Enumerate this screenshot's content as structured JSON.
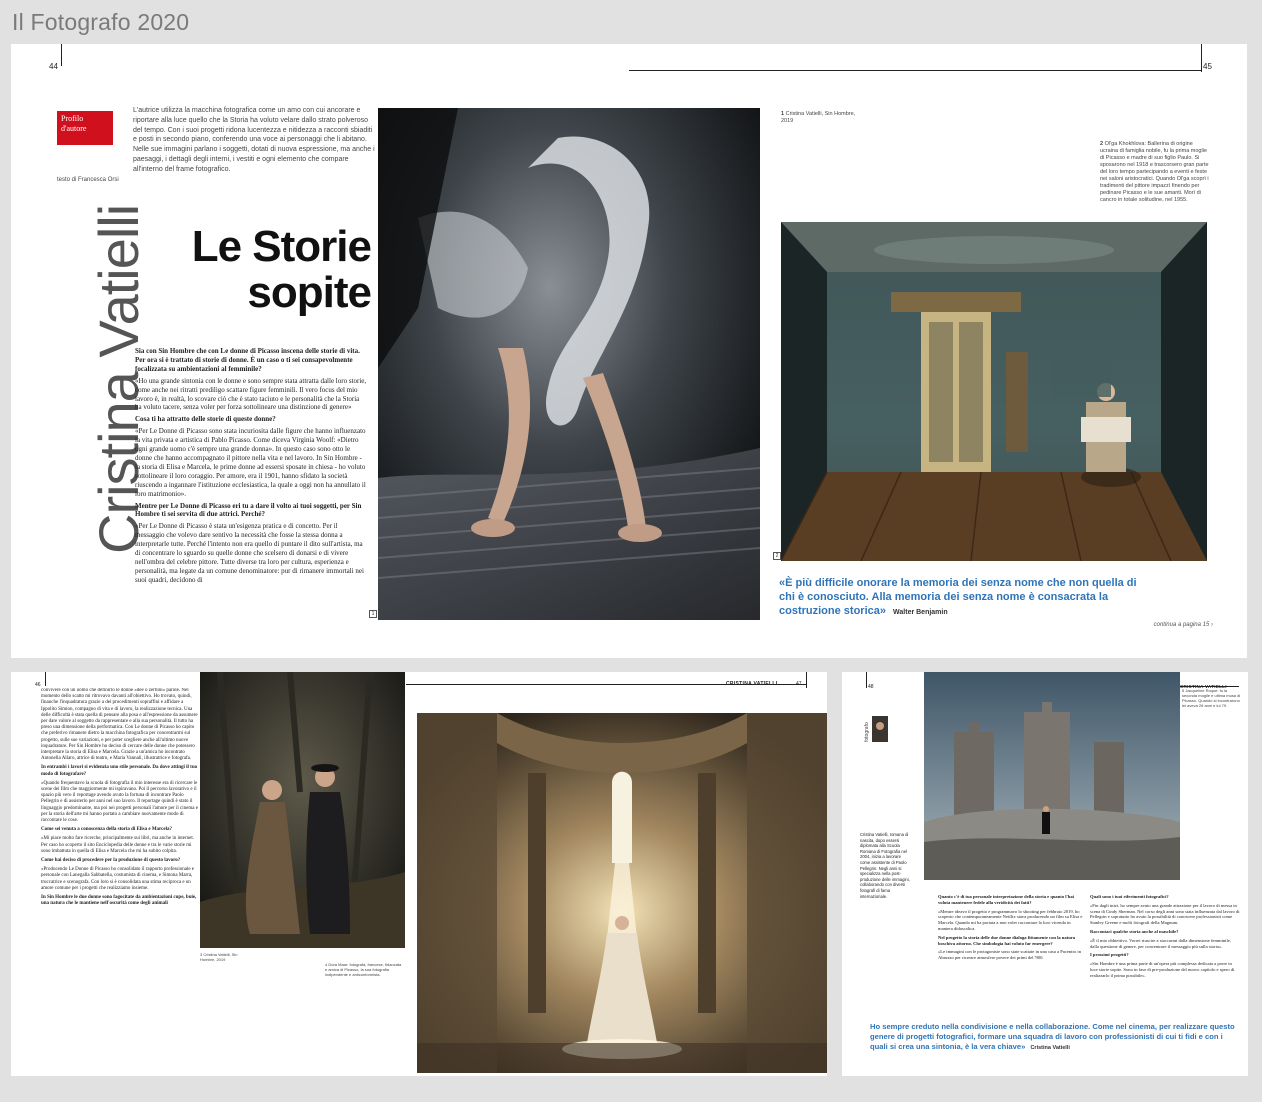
{
  "app": {
    "title": "Il Fotografo 2020"
  },
  "top_spread": {
    "page_left": "44",
    "page_right": "45",
    "section_label": "Profilo d'autore",
    "byline": "testo di Francesca Orsi",
    "author_name": "Cristina Vatielli",
    "headline_line1": "Le Storie",
    "headline_line2": "sopite",
    "intro_text": "L'autrice utilizza la macchina fotografica come un amo con cui ancorare e riportare alla luce quello che la Storia ha voluto velare dallo strato polveroso del tempo. Con i suoi progetti ridona lucentezza e nitidezza a racconti sbiaditi e posti in secondo piano, conferendo una voce ai personaggi che li abitano. Nelle sue immagini parlano i soggetti, dotati di nuova espressione, ma anche i paesaggi, i dettagli degli interni, i vestiti e ogni elemento che compare all'interno del frame fotografico.",
    "q1": "Sia con Sin Hombre che con Le donne di Picasso inscena delle storie di vita. Per ora si è trattato di storie di donne. È un caso o ti sei consapevolmente focalizzata su ambientazioni al femminile?",
    "a1": "«Ho una grande sintonia con le donne e sono sempre stata attratta dalle loro storie, come anche nei ritratti prediligo scattare figure femminili. Il vero focus del mio lavoro è, in realtà, lo scovare ciò che è stato taciuto e le personalità che la Storia ha voluto tacere, senza voler per forza sottolineare una distinzione di genere»",
    "q2": "Cosa ti ha attratto delle storie di queste donne?",
    "a2": "«Per Le Donne di Picasso sono stata incuriosita dalle figure che hanno influenzato la vita privata e artistica di Pablo Picasso. Come diceva Virginia Woolf: «Dietro ogni grande uomo c'è sempre una grande donna». In questo caso sono otto le donne che hanno accompagnato il pittore nella vita e nel lavoro. In Sin Hombre - la storia di Elisa e Marcela, le prime donne ad essersi sposate in chiesa - ho voluto sottolineare il loro coraggio. Per amore, era il 1901, hanno sfidato la società riuscendo a ingannare l'istituzione ecclesiastica, la quale a oggi non ha annullato il loro matrimonio».",
    "q3": "Mentre per Le Donne di Picasso eri tu a dare il volto ai tuoi soggetti, per Sin Hombre ti sei servita di due attrici. Perché?",
    "a3": "«Per Le Donne di Picasso è stata un'esigenza pratica e di concetto. Per il messaggio che volevo dare sentivo la necessità che fosse la stessa donna a interpretarle tutte. Perché l'intento non era quello di puntare il dito sull'artista, ma di concentrare lo sguardo su quelle donne che scelsero di donarsi e di vivere nell'ombra del celebre pittore. Tutte diverse tra loro per cultura, esperienza e personalità, ma legate da un comune denominatore: pur di rimanere immortali nei suoi quadri, decidono di",
    "photo1_num": "1",
    "caption1_num": "1",
    "caption1": "Cristina Vatielli, Sin Hombre, 2019",
    "caption2_num": "2",
    "caption2": "Ol'ga Khokhlova: Ballerina di origine ucraina di famiglia nobile, fu la prima moglie di Picasso e madre di suo figlio Paulo. Si sposarono nel 1918 e trascorsero gran parte del loro tempo partecipando a eventi e feste nei saloni aristocratici. Quando Ol'ga scoprì i tradimenti del pittore impazzì finendo per pedinare Picasso e le sue amanti. Morì di cancro in totale solitudine, nel 1955.",
    "photo2_num": "2",
    "quote": "«È più difficile onorare la memoria dei senza nome che non quella di chi è conosciuto. Alla memoria dei senza nome è consacrata la costruzione storica»",
    "quote_author": "Walter Benjamin",
    "continued": "continua a pagina 15"
  },
  "mid_spread": {
    "page_left": "46",
    "page_right": "47",
    "running_head": "CRISTINA VATIELLI",
    "caption3": "3 Cristina Vatielli, Sin Hombre, 2019",
    "caption4": "4 Dora Maar: fotografa, francese, fidanzata e amica di Picasso, la sua fotografia indipendente e anticonformista.",
    "text_a": "convivere con un uomo che definirlo le donne «dee o zerbini» parole. Nel momento dello scatto mi ritrovavo davanti all'obiettivo. Ho trovato, quindi, finanche l'inquadratura grazie a dei procedimenti sopraffini e affidare a Ippolito Simion, compagno di vita e di lavoro, la realizzazione tecnica. Una delle difficoltà è stata quella di pensare alla posa e all'espressione da assumere per dare valore al soggetto da rappresentare e alla sua personalità. Il tutto ha preso una dimensione della performatica. Con Le donne di Picasso ho capito che preferivo rimanere dietro la macchina fotografica per concentrarmi sul progetto, sulle sue variazioni, e per poter scegliere anche all'ultimo nuove inquadrature. Per Sin Hombre ho deciso di cercare delle donne che potessero interpretare la storia di Elisa e Marcela. Grazie a un'amica ho incontrato Antonella Allaro, attrice di teatro, e Maria Vannali, illustratrice e fotografa.",
    "q4": "In entrambi i lavori si evidenzia uno stile personale. Da dove attingi il tuo modo di fotografare?",
    "text_b": "«Quando frequentavo la scuola di fotografia il mio interesse era di ricercare le scene dei film che maggiormente mi ispiravano. Poi il percorso lavorativo e il spazio più vero il reportage avendo avuto la fortuna di incontrare Paolo Pellegrin e di assisterlo per anni nel suo lavoro. Il reportage quindi è stato il linguaggio predominante, ma poi nei progetti personali l'amore per il cinema e per la storia dell'arte mi hanno portato a cambiare nuovamente modo di raccontare le cose.",
    "q5": "Come sei venuta a conoscenza della storia di Elisa e Marcela?",
    "text_c": "«Mi piace molto fare ricerche, principalmente sui libri, ma anche in internet. Per caso ho scoperto il sito Enciclopedia delle donne e tra le varie storie mi sono imbattuta in quella di Elisa e Marcela che mi ha subito colpita.",
    "q6": "Come hai deciso di procedere per la produzione di questo lavoro?",
    "text_d": "«Producendo Le Donne di Picasso ho consolidato il rapporto professionale e personale con Lanegalla Sabbatella, costumista di cinema, e Simona Marra, truccatrice e scenografa. Con loro si è consolidata una stima reciproca e un amore comune per i progetti che realizziamo insieme.",
    "q7": "In Sin Hombre le due donne sono fagocitate da ambientazioni cupe, buie, una natura che le mantiene nell'oscurità come degli animali"
  },
  "right_spread": {
    "page_left": "48",
    "running_head": "CRISTINA VATIELLI",
    "side_label": "fotografo",
    "bio": "Cristina Vatielli, romana di nascita, dopo essersi diplomata alla Scuola Romana di Fotografia nel 2004, inizia a lavorare come assistente di Paolo Pellegrin. Negli anni si specializza nella post-produzione delle immagini, collaborando con diversi fotografi di fama internazionale.",
    "caption5": "5 Jacqueline Roque: fu la seconda moglie e ultima musa di Picasso. Quando si incontrarono lei aveva 26 anni e lui 79.",
    "q8": "Quanto c'è di tua personale interpretazione della storia e quanto l'hai voluta mantenere fedele alla veridicità dei fatti?",
    "text_e": "«Mentre ideavo il progetto e programmavo lo shooting per febbraio 2019, ho scoperto che contemporaneamente Netflix stava producendo un film su Elisa e Marcela. Quando mi ha portata a non voler raccontare la loro vicenda in maniera didascalica.",
    "q9": "Nel progetto la storia delle due donne dialoga fittamente con la natura boschiva attorno. Che simbologia hai voluto far emergere?",
    "text_f": "«Le immagini con le protagoniste sono state scattate in una casa a Pacentro in Abruzzo per ricreare atmosfere povere dei primi del '900.",
    "q10": "Quali sono i tuoi riferimenti fotografici?",
    "text_g": "«Fin dagli inizi, ho sempre avuto una grande attrazione per il lavoro di messa in scena di Cindy Sherman. Nel corso degli anni sono stata influenzata dal lavoro di Pellegrin e sopratutto ho avuto la possibilità di conoscere professionisti come Stanley Greene e molti fotografi della Magnum.",
    "q11": "Raccontaci qualche storia anche al maschile?",
    "text_h": "«È il mio obbiettivo. Vorrei riuscire a staccarmi dalla dimensione femminile, dalla questione di genere, per concentrare il messaggio più sulla storia».",
    "q12": "I prossimi progetti?",
    "text_i": "«Sin Hombre è una prima parte di un'opera più complessa dedicata a porre in luce storie sopite. Sono in fase di pre-produzione del nuovo capitolo e spero di realizzarlo il prima possibile».",
    "quote2": "Ho sempre creduto nella condivisione e nella collaborazione. Come nel cinema, per realizzare questo genere di progetti fotografici, formare una squadra di lavoro con professionisti di cui ti fidi e con i quali si crea una sintonia, è la vera chiave»",
    "quote2_author": "Cristina Vatielli"
  },
  "colors": {
    "accent_red": "#d0101c",
    "quote_blue": "#2f74b8",
    "background": "#e1e1e1"
  }
}
